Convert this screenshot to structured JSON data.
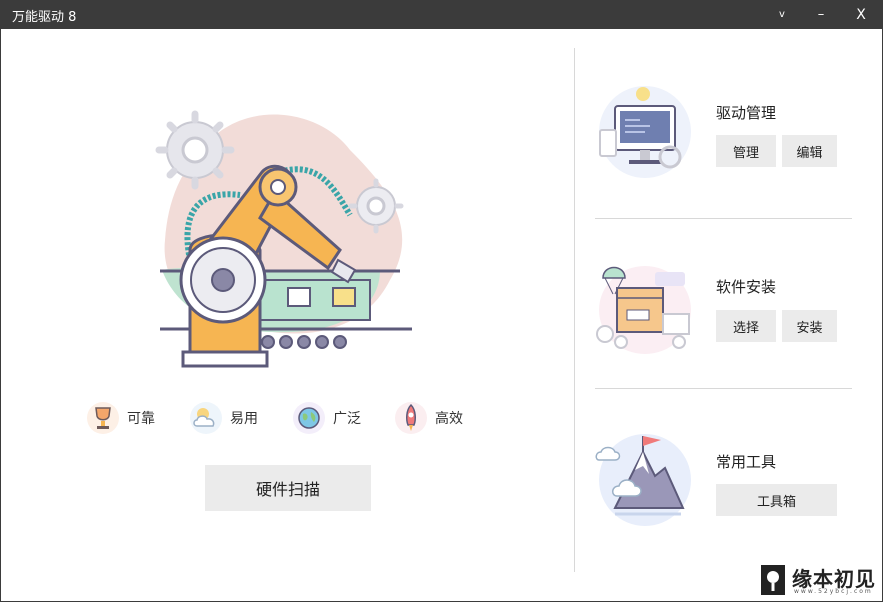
{
  "window": {
    "title": "万能驱动 8",
    "controls": {
      "dropdown": "v",
      "minimize": "–",
      "close": "X"
    }
  },
  "features": [
    {
      "icon": "trophy-icon",
      "label": "可靠"
    },
    {
      "icon": "cloud-sun-icon",
      "label": "易用"
    },
    {
      "icon": "globe-icon",
      "label": "广泛"
    },
    {
      "icon": "rocket-icon",
      "label": "高效"
    }
  ],
  "scan_button": "硬件扫描",
  "sections": {
    "driver": {
      "title": "驱动管理",
      "buttons": [
        "管理",
        "编辑"
      ]
    },
    "software": {
      "title": "软件安装",
      "buttons": [
        "选择",
        "安装"
      ]
    },
    "tools": {
      "title": "常用工具",
      "buttons": [
        "工具箱"
      ]
    }
  },
  "watermark": {
    "text": "缘本初见",
    "sub": "www.52ybcj.com"
  },
  "colors": {
    "titlebar": "#3b3b3b",
    "button_bg": "#ebebeb",
    "accent_orange": "#f6b552",
    "accent_teal": "#3aa5a8"
  }
}
